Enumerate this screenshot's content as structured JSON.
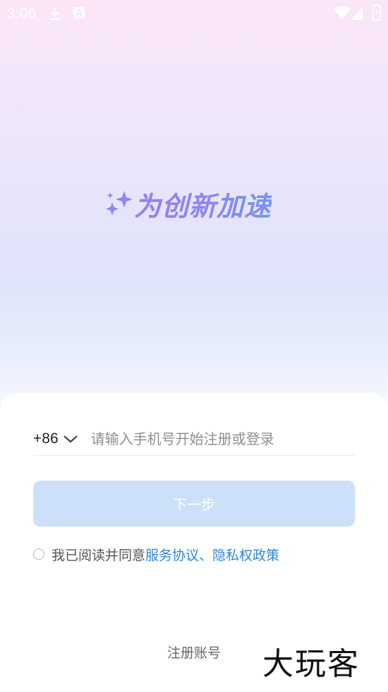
{
  "status_bar": {
    "time": "3:06"
  },
  "slogan": {
    "text": "为创新加速",
    "gradient_colors": [
      "#9b7cf0",
      "#7a93ef"
    ]
  },
  "login": {
    "country_code": "+86",
    "phone_placeholder": "请输入手机号开始注册或登录",
    "next_label": "下一步",
    "agree_prefix": "我已阅读并同意",
    "terms_link": "服务协议",
    "separator": "、",
    "privacy_link": "隐私权政策",
    "register_label": "注册账号"
  },
  "watermark": {
    "text": "大玩客"
  },
  "colors": {
    "accent": "#2f86d6",
    "button_disabled": "#cde0f9"
  },
  "icons": [
    "download-icon",
    "a-icon",
    "wifi-icon",
    "signal-icon",
    "battery-icon",
    "sparkle-icon",
    "chevron-down-icon"
  ]
}
